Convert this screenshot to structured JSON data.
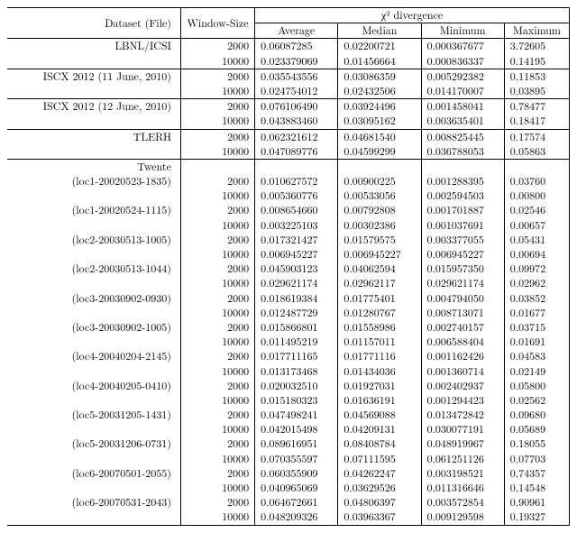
{
  "headers": {
    "dataset": "Dataset (File)",
    "window": "Window-Size",
    "chi": "χ² divergence",
    "avg": "Average",
    "med": "Median",
    "min": "Minimum",
    "max": "Maximum"
  },
  "groups": [
    {
      "name": "LBNL/ICSI",
      "rows": [
        {
          "win": "2000",
          "avg": "0.06087285",
          "med": "0.02200721",
          "min": "0.000367677",
          "max": "3.72605"
        },
        {
          "win": "10000",
          "avg": "0.023379069",
          "med": "0.01456664",
          "min": "0.000836337",
          "max": "0.14195"
        }
      ],
      "sep": true
    },
    {
      "name": "ISCX 2012 (11 June, 2010)",
      "rows": [
        {
          "win": "2000",
          "avg": "0.035543556",
          "med": "0.03086359",
          "min": "0.005292382",
          "max": "0.11853"
        },
        {
          "win": "10000",
          "avg": "0.024754012",
          "med": "0.02432506",
          "min": "0.014170007",
          "max": "0.03895"
        }
      ],
      "sep": true
    },
    {
      "name": "ISCX 2012 (12 June, 2010)",
      "rows": [
        {
          "win": "2000",
          "avg": "0.076106490",
          "med": "0.03924496",
          "min": "0.001458041",
          "max": "0.78477"
        },
        {
          "win": "10000",
          "avg": "0.043883460",
          "med": "0.03095162",
          "min": "0.003635401",
          "max": "0.18417"
        }
      ],
      "sep": true
    },
    {
      "name": "TLERH",
      "rows": [
        {
          "win": "2000",
          "avg": "0.062321612",
          "med": "0.04681540",
          "min": "0.008825445",
          "max": "0.17574"
        },
        {
          "win": "10000",
          "avg": "0.047089776",
          "med": "0.04599299",
          "min": "0.036788053",
          "max": "0.05863"
        }
      ],
      "sep": true
    },
    {
      "name": "Twente",
      "rows": [],
      "sep": true,
      "header_only": true
    },
    {
      "name": "(loc1-20020523-1835)",
      "rows": [
        {
          "win": "2000",
          "avg": "0.010627572",
          "med": "0.00900225",
          "min": "0.001288395",
          "max": "0.03760"
        },
        {
          "win": "10000",
          "avg": "0.005360776",
          "med": "0.00533056",
          "min": "0.002594503",
          "max": "0.00800"
        }
      ]
    },
    {
      "name": "(loc1-20020524-1115)",
      "rows": [
        {
          "win": "2000",
          "avg": "0.008654660",
          "med": "0.00792808",
          "min": "0.001701887",
          "max": "0.02546"
        },
        {
          "win": "10000",
          "avg": "0.003225103",
          "med": "0.00302386",
          "min": "0.001037691",
          "max": "0.00657"
        }
      ]
    },
    {
      "name": "(loc2-20030513-1005)",
      "rows": [
        {
          "win": "2000",
          "avg": "0.017321427",
          "med": "0.01579575",
          "min": "0.003377055",
          "max": "0.05431"
        },
        {
          "win": "10000",
          "avg": "0.006945227",
          "med": "0.006945227",
          "min": "0.006945227",
          "max": "0.00694"
        }
      ]
    },
    {
      "name": "(loc2-20030513-1044)",
      "rows": [
        {
          "win": "2000",
          "avg": "0.045903123",
          "med": "0.04062594",
          "min": "0.015957350",
          "max": "0.09972"
        },
        {
          "win": "10000",
          "avg": "0.029621174",
          "med": "0.02962117",
          "min": "0.029621174",
          "max": "0.02962"
        }
      ]
    },
    {
      "name": "(loc3-20030902-0930)",
      "rows": [
        {
          "win": "2000",
          "avg": "0.018619384",
          "med": "0.01775401",
          "min": "0.004794050",
          "max": "0.03852"
        },
        {
          "win": "10000",
          "avg": "0.012487729",
          "med": "0.01280767",
          "min": "0.008713071",
          "max": "0.01677"
        }
      ]
    },
    {
      "name": "(loc3-20030902-1005)",
      "rows": [
        {
          "win": "2000",
          "avg": "0.015866801",
          "med": "0.01558986",
          "min": "0.002740157",
          "max": "0.03715"
        },
        {
          "win": "10000",
          "avg": "0.011495219",
          "med": "0.01157011",
          "min": "0.006588404",
          "max": "0.01691"
        }
      ]
    },
    {
      "name": "(loc4-20040204-2145)",
      "rows": [
        {
          "win": "2000",
          "avg": "0.017711165",
          "med": "0.01771116",
          "min": "0.001162426",
          "max": "0.04583"
        },
        {
          "win": "10000",
          "avg": "0.013173468",
          "med": "0.01434036",
          "min": "0.001360714",
          "max": "0.02149"
        }
      ]
    },
    {
      "name": "(loc4-20040205-0410)",
      "rows": [
        {
          "win": "2000",
          "avg": "0.020032510",
          "med": "0.01927031",
          "min": "0.002402937",
          "max": "0.05800"
        },
        {
          "win": "10000",
          "avg": "0.015180323",
          "med": "0.01636191",
          "min": "0.001294423",
          "max": "0.02562"
        }
      ]
    },
    {
      "name": "(loc5-20031205-1431)",
      "rows": [
        {
          "win": "2000",
          "avg": "0.047498241",
          "med": "0.04569088",
          "min": "0.013472842",
          "max": "0.09680"
        },
        {
          "win": "10000",
          "avg": "0.042015498",
          "med": "0.04209131",
          "min": "0.030077191",
          "max": "0.05689"
        }
      ]
    },
    {
      "name": "(loc5-20031206-0731)",
      "rows": [
        {
          "win": "2000",
          "avg": "0.089616951",
          "med": "0.08408784",
          "min": "0.048919967",
          "max": "0.18055"
        },
        {
          "win": "10000",
          "avg": "0.070355597",
          "med": "0.07111595",
          "min": "0.061251126",
          "max": "0.07703"
        }
      ]
    },
    {
      "name": "(loc6-20070501-2055)",
      "rows": [
        {
          "win": "2000",
          "avg": "0.060355909",
          "med": "0.04262247",
          "min": "0.003198521",
          "max": "0.74357"
        },
        {
          "win": "10000",
          "avg": "0.040965069",
          "med": "0.03629526",
          "min": "0.011316646",
          "max": "0.14548"
        }
      ]
    },
    {
      "name": "(loc6-20070531-2043)",
      "rows": [
        {
          "win": "2000",
          "avg": "0.064672661",
          "med": "0.04806397",
          "min": "0.003572854",
          "max": "0.90961"
        },
        {
          "win": "10000",
          "avg": "0.048209326",
          "med": "0.03963367",
          "min": "0.009129598",
          "max": "0.19327"
        }
      ]
    }
  ]
}
